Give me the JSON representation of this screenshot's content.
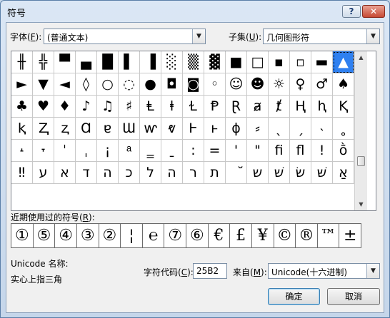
{
  "window": {
    "title": "符号",
    "help": "?",
    "close": "✕"
  },
  "font": {
    "label_pre": "字体(",
    "label_key": "F",
    "label_post": "):",
    "value": "(普通文本)"
  },
  "subset": {
    "label_pre": "子集(",
    "label_key": "U",
    "label_post": "):",
    "value": "几何图形符"
  },
  "grid_symbols": [
    "╫",
    "╬",
    "▀",
    "▄",
    "█",
    "▌",
    "▐",
    "░",
    "▒",
    "▓",
    "■",
    "□",
    "▪",
    "▫",
    "▬",
    "▲",
    "►",
    "▼",
    "◄",
    "◊",
    "○",
    "◌",
    "●",
    "◘",
    "◙",
    "◦",
    "☺",
    "☻",
    "☼",
    "♀",
    "♂",
    "♠",
    "♣",
    "♥",
    "♦",
    "♪",
    "♫",
    "♯",
    "Ⱡ",
    "ⱡ",
    "Ɫ",
    "Ᵽ",
    "Ɽ",
    "ⱥ",
    "ⱦ",
    "Ⱨ",
    "ⱨ",
    "Ⱪ",
    "ⱪ",
    "Ⱬ",
    "ⱬ",
    "Ɑ",
    "ɐ",
    "Ɯ",
    "ⱳ",
    "ⱴ",
    "Ⱶ",
    "ⱶ",
    "ɸ",
    "⸗",
    "ˎ",
    "ˏ",
    "˴",
    "˳",
    "˔",
    "˕",
    "ˈ",
    "ˌ",
    "¡",
    "ͣ",
    "‗",
    "ˍ",
    ":",
    "=",
    "'",
    "\"",
    "ﬁ",
    "ﬂ",
    "!",
    "ṑ",
    "‼",
    "ע",
    "א",
    "ד",
    "ה",
    "כ",
    "ל",
    "ה",
    "ר",
    "ת",
    "ﬞ",
    "ש",
    "שׁ",
    "שׂ",
    "שּׁ",
    "אַ"
  ],
  "recent": {
    "label_pre": "近期使用过的符号(",
    "label_key": "R",
    "label_post": "):",
    "symbols": [
      "①",
      "⑤",
      "④",
      "③",
      "②",
      "¦",
      "℮",
      "⑦",
      "⑥",
      "€",
      "£",
      "¥",
      "©",
      "®",
      "™",
      "±"
    ]
  },
  "unicode_name": {
    "label": "Unicode 名称:",
    "value": "实心上指三角"
  },
  "char_code": {
    "label_pre": "字符代码(",
    "label_key": "C",
    "label_post": "):",
    "value": "25B2"
  },
  "from": {
    "label_pre": "来自(",
    "label_key": "M",
    "label_post": "):",
    "value": "Unicode(十六进制)"
  },
  "buttons": {
    "ok": "确定",
    "cancel": "取消"
  },
  "icons": {
    "dropdown": "chevron-down-icon",
    "scroll_up": "scroll-up-icon",
    "scroll_down": "scroll-down-icon"
  }
}
